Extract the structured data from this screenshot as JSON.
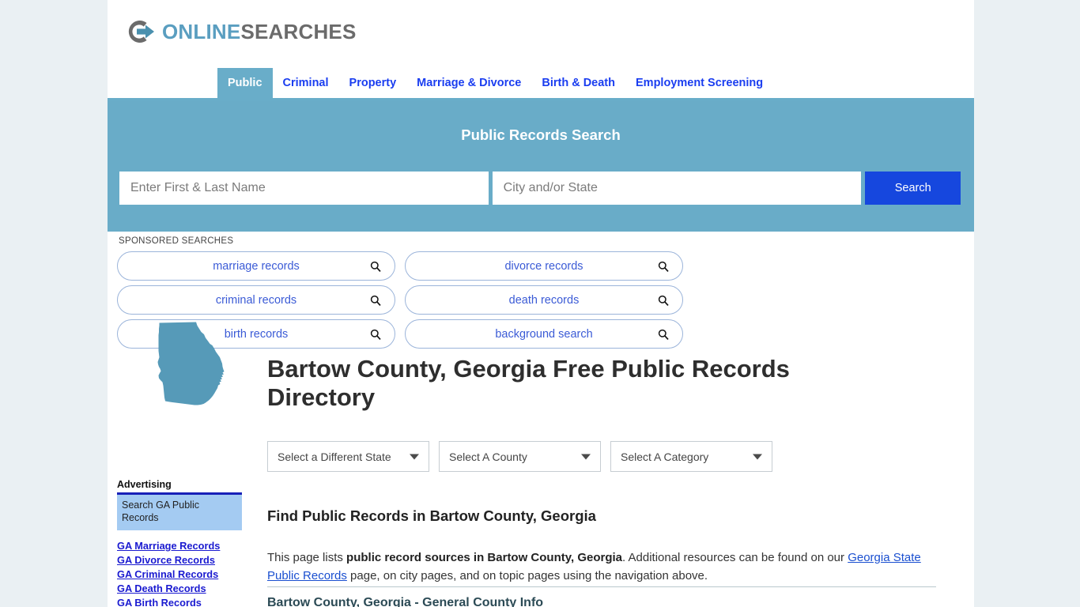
{
  "brand": {
    "logo_icon": "circle-arrow-logo-icon",
    "name_part1": "ONLINE",
    "name_part2": "SEARCHES",
    "accent_blue": "#5a9ec0",
    "accent_gray": "#6b6b6b"
  },
  "nav": {
    "tabs": [
      {
        "label": "Public",
        "active": true
      },
      {
        "label": "Criminal",
        "active": false
      },
      {
        "label": "Property",
        "active": false
      },
      {
        "label": "Marriage & Divorce",
        "active": false
      },
      {
        "label": "Birth & Death",
        "active": false
      },
      {
        "label": "Employment Screening",
        "active": false
      }
    ]
  },
  "search": {
    "title": "Public Records Search",
    "name_placeholder": "Enter First & Last Name",
    "name_value": "",
    "city_placeholder": "City and/or State",
    "city_value": "",
    "button_label": "Search",
    "band_color": "#69acc8",
    "button_color": "#1647de"
  },
  "sponsored": {
    "label": "SPONSORED SEARCHES",
    "items": [
      {
        "label": "marriage records"
      },
      {
        "label": "divorce records"
      },
      {
        "label": "criminal records"
      },
      {
        "label": "death records"
      },
      {
        "label": "birth records"
      },
      {
        "label": "background search"
      }
    ]
  },
  "page": {
    "state_map_alt": "georgia-state-map",
    "title": "Bartow County, Georgia Free Public Records Directory",
    "section_heading": "Find Public Records in Bartow County, Georgia",
    "intro_pre": "This page lists ",
    "intro_bold": "public record sources in Bartow County, Georgia",
    "intro_mid": ". Additional resources can be found on our ",
    "intro_link": "Georgia State Public Records",
    "intro_post": " page, on city pages, and on topic pages using the navigation above.",
    "next_section_heading": "Bartow County, Georgia - General County Info"
  },
  "selects": {
    "state": "Select a Different State",
    "county": "Select A County",
    "category": "Select A Category"
  },
  "sidebar": {
    "heading": "Advertising",
    "ad_box_text": "Search GA Public Records",
    "links": [
      {
        "label": "GA Marriage Records"
      },
      {
        "label": "GA Divorce Records"
      },
      {
        "label": "GA Criminal Records"
      },
      {
        "label": "GA Death Records"
      },
      {
        "label": "GA Birth Records"
      }
    ]
  }
}
